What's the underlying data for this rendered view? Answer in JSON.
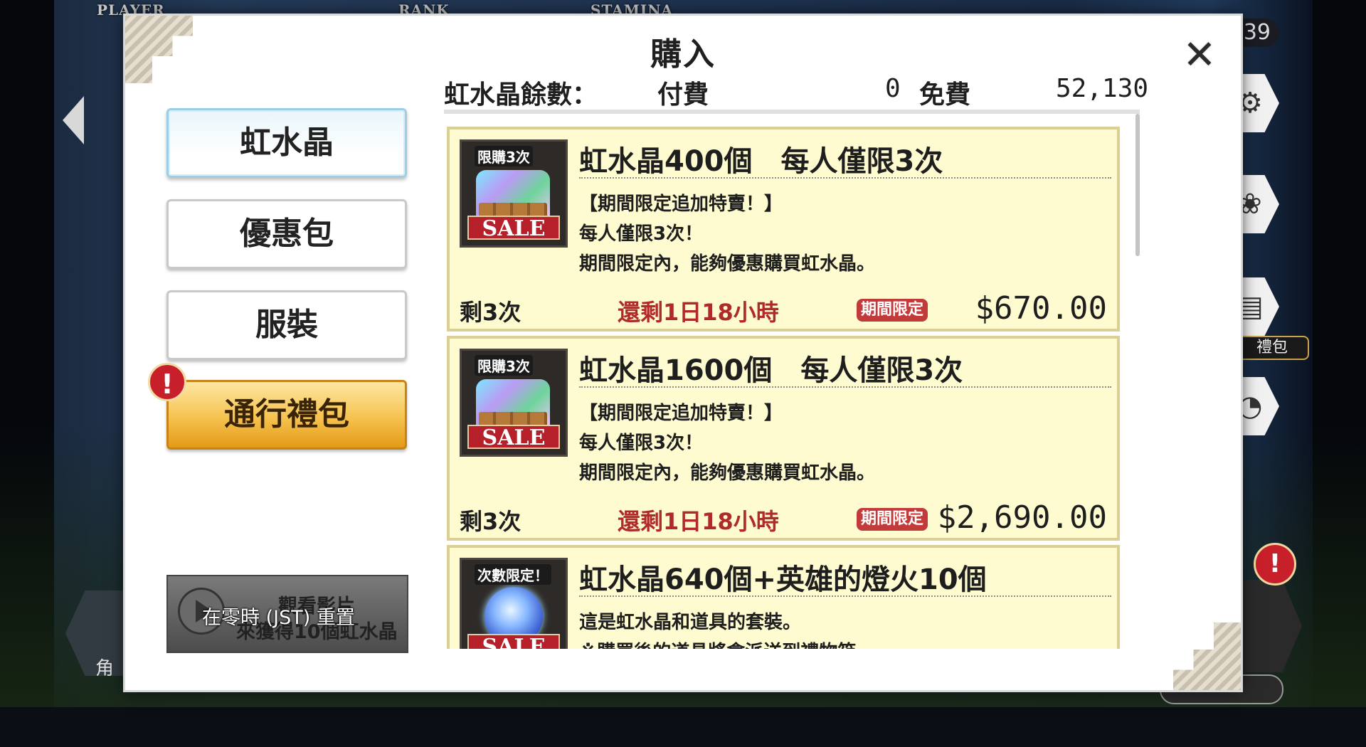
{
  "hud": {
    "player_label": "PLAYER",
    "rank_label": "RANK",
    "stamina_label": "STAMINA",
    "right_counter": "39",
    "side_label": "禮包",
    "left_hex_label": "角",
    "bottom_pill": ""
  },
  "dialog": {
    "title": "購入",
    "close_glyph": "✕",
    "balance": {
      "label": "虹水晶餘數：",
      "paid_label": "付費",
      "paid_value": "0",
      "free_label": "免費",
      "free_value": "52,130"
    },
    "tabs": [
      {
        "label": "虹水晶",
        "state": "active"
      },
      {
        "label": "優惠包",
        "state": "normal"
      },
      {
        "label": "服裝",
        "state": "normal"
      },
      {
        "label": "通行禮包",
        "state": "highlight"
      }
    ],
    "alert_glyph": "!",
    "video_button": {
      "line1": "觀看影片",
      "line2": "來獲得10個虹水晶"
    },
    "toast": "在零時 (JST) 重置",
    "products": [
      {
        "tag": "限購3次",
        "badge": "SALE",
        "name": "虹水晶400個　每人僅限3次",
        "desc": [
          "【期間限定追加特賣！】",
          "每人僅限3次！",
          "期間限定內，能夠優惠購買虹水晶。"
        ],
        "remaining": "剩3次",
        "timer": "還剩1日18小時",
        "limited": "期間限定",
        "price": "$670.00"
      },
      {
        "tag": "限購3次",
        "badge": "SALE",
        "name": "虹水晶1600個　每人僅限3次",
        "desc": [
          "【期間限定追加特賣！】",
          "每人僅限3次！",
          "期間限定內，能夠優惠購買虹水晶。"
        ],
        "remaining": "剩3次",
        "timer": "還剩1日18小時",
        "limited": "期間限定",
        "price": "$2,690.00"
      },
      {
        "tag": "次數限定！",
        "badge": "SALE",
        "name": "虹水晶640個+英雄的燈火10個",
        "desc": [
          "這是虹水晶和道具的套裝。",
          "※購買後的道具將會派送到禮物箱"
        ],
        "remaining": "",
        "timer": "",
        "limited": "",
        "price": ""
      }
    ]
  }
}
